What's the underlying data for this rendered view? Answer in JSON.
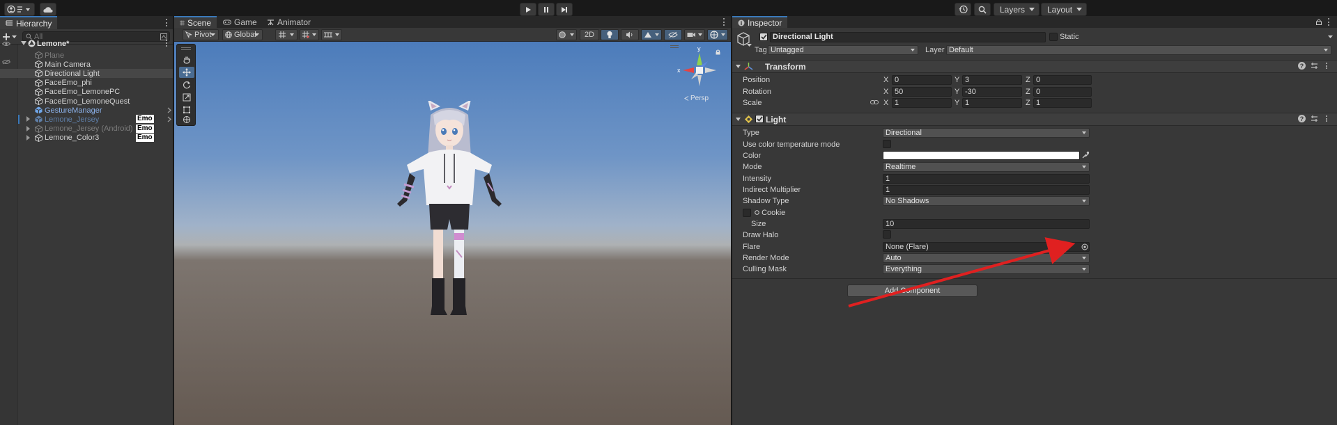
{
  "toolbar": {
    "cloud_icon": "cloud-icon",
    "layers_label": "Layers",
    "layout_label": "Layout"
  },
  "hierarchy": {
    "tab_label": "Hierarchy",
    "search_placeholder": "All",
    "scene_name": "Lemone*",
    "items": [
      {
        "label": "Plane",
        "state": "disabled"
      },
      {
        "label": "Main Camera",
        "state": "normal"
      },
      {
        "label": "Directional Light",
        "state": "selected"
      },
      {
        "label": "FaceEmo_phi",
        "state": "normal"
      },
      {
        "label": "FaceEmo_LemonePC",
        "state": "normal"
      },
      {
        "label": "FaceEmo_LemoneQuest",
        "state": "normal"
      },
      {
        "label": "GestureManager",
        "state": "prefab"
      },
      {
        "label": "Lemone_Jersey",
        "state": "prefab-disabled",
        "badge": "Emo"
      },
      {
        "label": "Lemone_Jersey (Android)",
        "state": "disabled",
        "badge": "Emo"
      },
      {
        "label": "Lemone_Color3",
        "state": "normal",
        "badge": "Emo"
      }
    ]
  },
  "scene": {
    "tabs": [
      {
        "label": "Scene",
        "active": true
      },
      {
        "label": "Game",
        "active": false
      },
      {
        "label": "Animator",
        "active": false
      }
    ],
    "pivot_label": "Pivot",
    "global_label": "Global",
    "mode_2d_label": "2D",
    "persp_label": "Persp",
    "gizmo_x_label": "x",
    "gizmo_y_label": "y"
  },
  "inspector": {
    "tab_label": "Inspector",
    "object_name": "Directional Light",
    "static_label": "Static",
    "tag_label": "Tag",
    "tag_value": "Untagged",
    "layer_label": "Layer",
    "layer_value": "Default",
    "transform": {
      "title": "Transform",
      "position_label": "Position",
      "rotation_label": "Rotation",
      "scale_label": "Scale",
      "position": {
        "x": "0",
        "y": "3",
        "z": "0"
      },
      "rotation": {
        "x": "50",
        "y": "-30",
        "z": "0"
      },
      "scale": {
        "x": "1",
        "y": "1",
        "z": "1"
      }
    },
    "light": {
      "title": "Light",
      "type_label": "Type",
      "type_value": "Directional",
      "color_temp_label": "Use color temperature mode",
      "color_label": "Color",
      "color_value": "#ffffff",
      "mode_label": "Mode",
      "mode_value": "Realtime",
      "intensity_label": "Intensity",
      "intensity_value": "1",
      "indirect_label": "Indirect Multiplier",
      "indirect_value": "1",
      "shadow_label": "Shadow Type",
      "shadow_value": "No Shadows",
      "cookie_label": "Cookie",
      "size_label": "Size",
      "size_value": "10",
      "halo_label": "Draw Halo",
      "flare_label": "Flare",
      "flare_value": "None (Flare)",
      "render_mode_label": "Render Mode",
      "render_mode_value": "Auto",
      "culling_label": "Culling Mask",
      "culling_value": "Everything"
    },
    "add_component_label": "Add Component"
  },
  "annotation": {
    "color": "#e02020"
  }
}
